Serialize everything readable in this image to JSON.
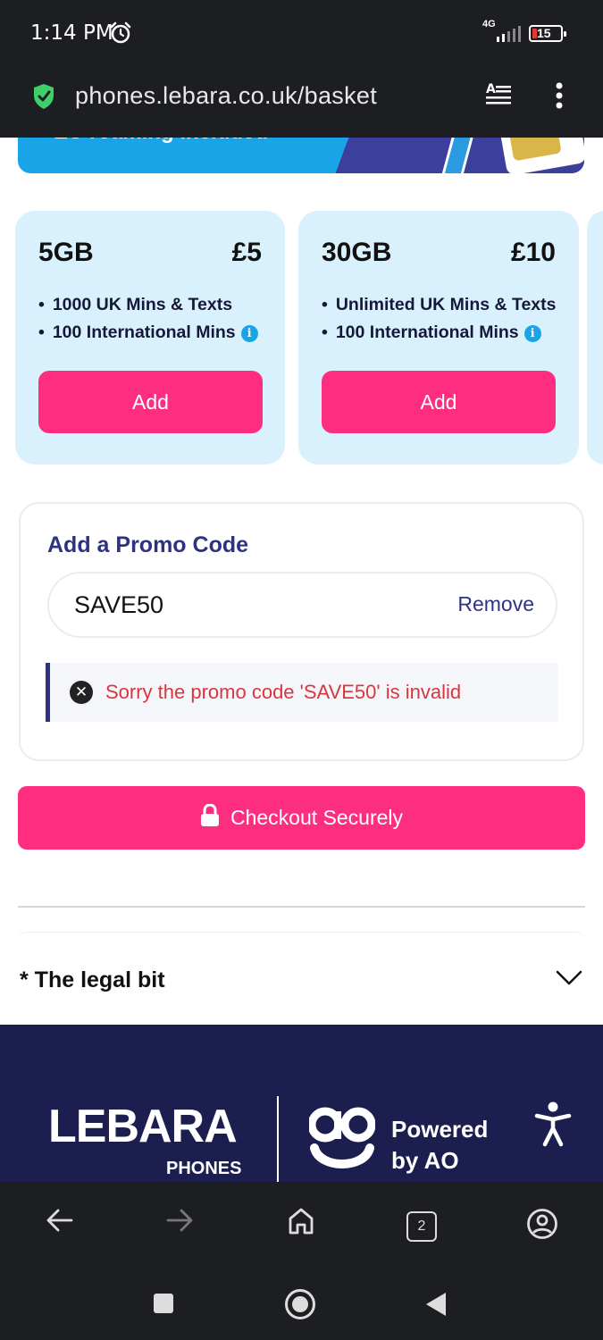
{
  "status_bar": {
    "time": "1:14 PM",
    "network": "4G",
    "battery": "15"
  },
  "browser": {
    "url": "phones.lebara.co.uk/basket",
    "tabs_count": "2"
  },
  "hero": {
    "text": "EU roaming included"
  },
  "plans": [
    {
      "data": "5GB",
      "price": "£5",
      "features": [
        "1000 UK Mins & Texts",
        "100 International Mins"
      ],
      "button": "Add"
    },
    {
      "data": "30GB",
      "price": "£10",
      "features": [
        "Unlimited UK Mins & Texts",
        "100 International Mins"
      ],
      "button": "Add"
    }
  ],
  "promo": {
    "title": "Add a Promo Code",
    "value": "SAVE50",
    "remove_label": "Remove",
    "error": "Sorry the promo code 'SAVE50' is invalid"
  },
  "checkout": {
    "label": "Checkout Securely"
  },
  "legal": {
    "label": "* The legal bit"
  },
  "footer": {
    "brand": "LEBARA",
    "brand_sub": "PHONES",
    "powered_line1": "Powered",
    "powered_line2": "by AO"
  },
  "colors": {
    "accent_pink": "#fd2e7f",
    "navy": "#2e3283",
    "footer_bg": "#1c1e50",
    "card_bg": "#d9f1fd",
    "error_red": "#d6373f"
  }
}
